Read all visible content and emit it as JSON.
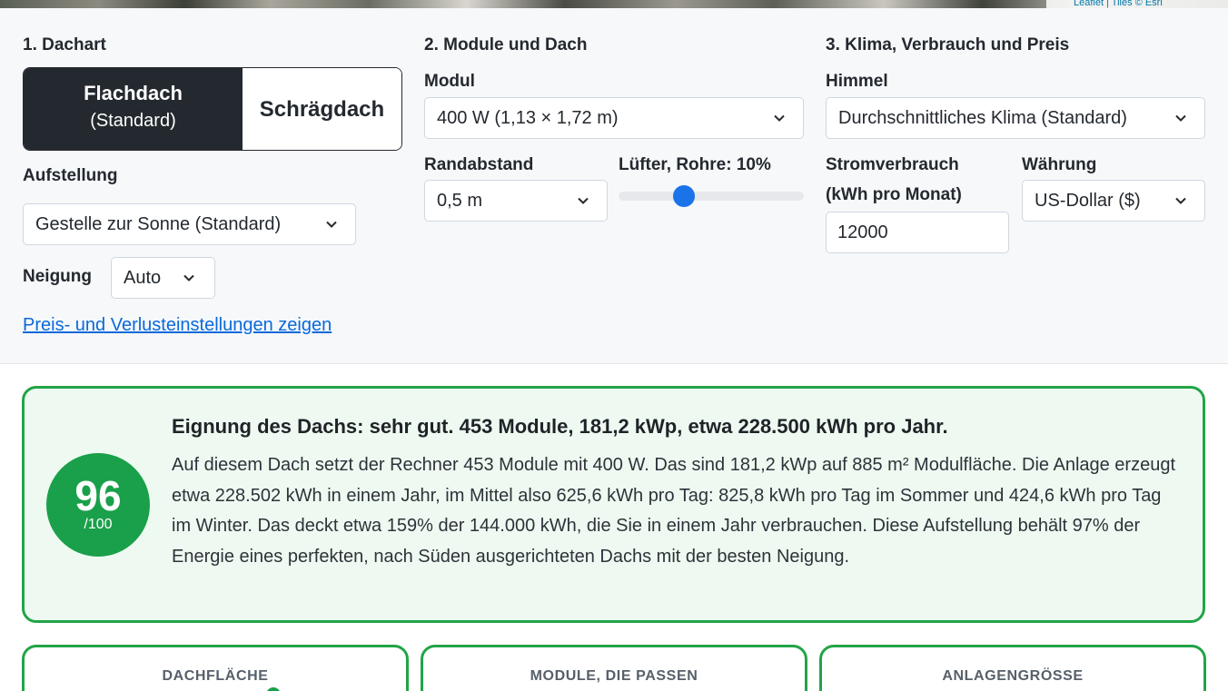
{
  "map_attribution": "Leaflet | Tiles © Esri",
  "section1": {
    "heading": "1. Dachart",
    "roof_flat_label": "Flachdach",
    "roof_flat_sub": "(Standard)",
    "roof_pitched_label": "Schrägdach",
    "mounting_label": "Aufstellung",
    "mounting_value": "Gestelle zur Sonne (Standard)",
    "tilt_label": "Neigung",
    "tilt_value": "Auto",
    "settings_link": "Preis- und Verlusteinstellungen zeigen"
  },
  "section2": {
    "heading": "2. Module und Dach",
    "module_label": "Modul",
    "module_value": "400 W (1,13 × 1,72 m)",
    "edge_label": "Randabstand",
    "edge_value": "0,5 m",
    "obstruction_label": "Lüfter, Rohre: 10%",
    "obstruction_percent": 10
  },
  "section3": {
    "heading": "3. Klima, Verbrauch und Preis",
    "sky_label": "Himmel",
    "sky_value": "Durchschnittliches Klima (Standard)",
    "consumption_label_1": "Stromverbrauch",
    "consumption_label_2": "(kWh pro Monat)",
    "consumption_value": "12000",
    "currency_label": "Währung",
    "currency_value": "US-Dollar ($)"
  },
  "summary": {
    "score": "96",
    "score_max": "/100",
    "title": "Eignung des Dachs: sehr gut. 453 Module, 181,2 kWp, etwa 228.500 kWh pro Jahr.",
    "body": "Auf diesem Dach setzt der Rechner 453 Module mit 400 W. Das sind 181,2 kWp auf 885 m² Modulfläche. Die Anlage erzeugt etwa 228.502 kWh in einem Jahr, im Mittel also 625,6 kWh pro Tag: 825,8 kWh pro Tag im Sommer und 424,6 kWh pro Tag im Winter. Das deckt etwa 159% der 144.000 kWh, die Sie in einem Jahr verbrauchen. Diese Aufstellung behält 97% der Energie eines perfekten, nach Süden ausgerichteten Dachs mit der besten Neigung."
  },
  "cards": [
    {
      "title": "DACHFLÄCHE"
    },
    {
      "title": "MODULE, DIE PASSEN"
    },
    {
      "title": "ANLAGENGRÖSSE"
    }
  ],
  "colors": {
    "accent_green": "#22a447",
    "score_green": "#1aa04a",
    "slider_blue": "#1a73e8",
    "link_blue": "#0969da",
    "dark": "#24292f"
  }
}
